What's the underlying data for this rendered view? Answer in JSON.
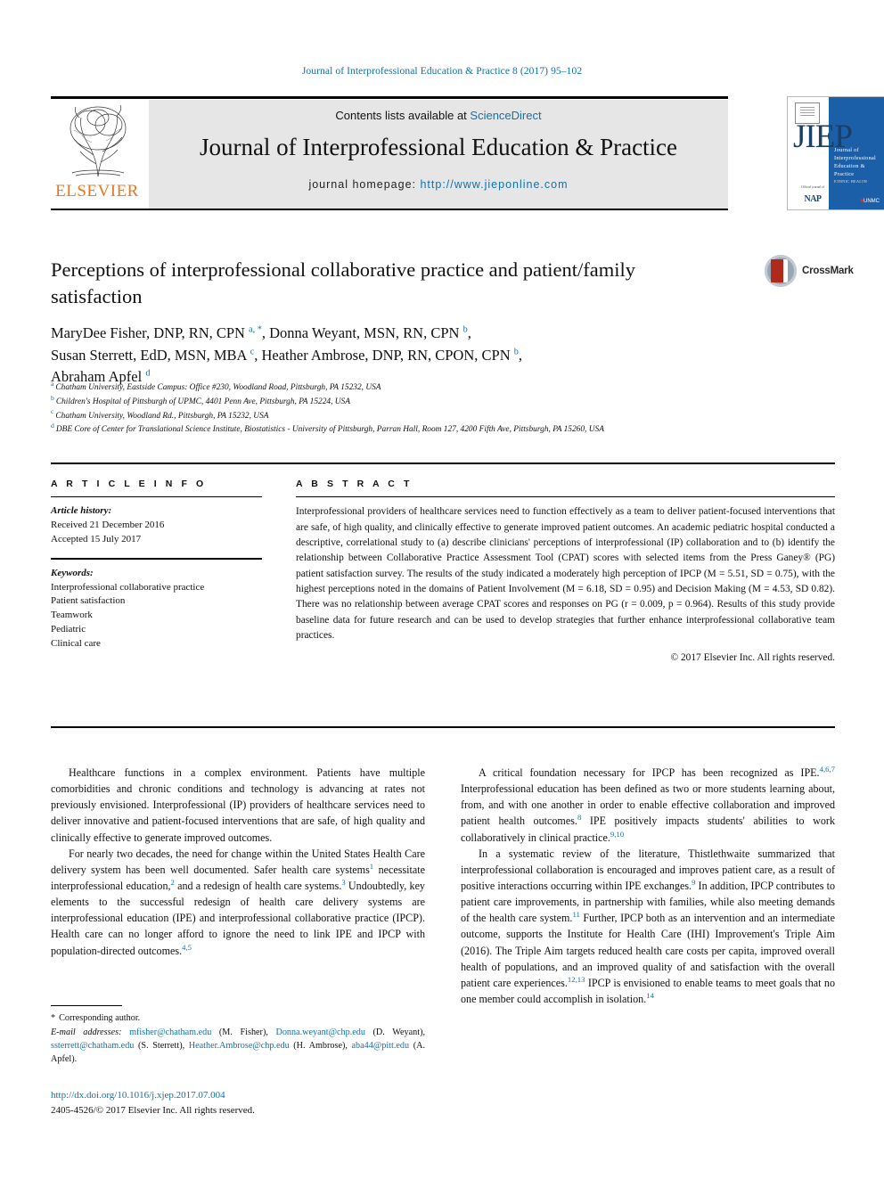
{
  "running_head": "Journal of Interprofessional Education & Practice 8 (2017) 95–102",
  "masthead": {
    "contents_prefix": "Contents lists available at ",
    "contents_link": "ScienceDirect",
    "journal_title": "Journal of Interprofessional Education & Practice",
    "homepage_prefix": "journal homepage: ",
    "homepage_url": "http://www.jieponline.com",
    "publisher": "ELSEVIER",
    "cover": {
      "acronym": "JIEP",
      "subtitle": "Journal of Interprofessional Education & Practice",
      "subtitle_small": "ETHNIC HEALTH",
      "nap_label": "Official journal of",
      "nap_badge": "NAP",
      "partner": "UNMC"
    }
  },
  "crossmark": {
    "label": "CrossMark"
  },
  "article": {
    "title": "Perceptions of interprofessional collaborative practice and patient/family satisfaction",
    "authors_html": "MaryDee Fisher, DNP, RN, CPN <sup>a, *</sup>, Donna Weyant, MSN, RN, CPN <sup>b</sup>,<br>Susan Sterrett, EdD, MSN, MBA <sup>c</sup>, Heather Ambrose, DNP, RN, CPON, CPN <sup>b</sup>,<br>Abraham Apfel <sup>d</sup>",
    "affiliations": [
      {
        "mark": "a",
        "text": "Chatham University, Eastside Campus: Office #230, Woodland Road, Pittsburgh, PA 15232, USA"
      },
      {
        "mark": "b",
        "text": "Children's Hospital of Pittsburgh of UPMC, 4401 Penn Ave, Pittsburgh, PA 15224, USA"
      },
      {
        "mark": "c",
        "text": "Chatham University, Woodland Rd., Pittsburgh, PA 15232, USA"
      },
      {
        "mark": "d",
        "text": "DBE Core of Center for Translational Science Institute, Biostatistics - University of Pittsburgh, Parran Hall, Room 127, 4200 Fifth Ave, Pittsburgh, PA 15260, USA"
      }
    ]
  },
  "article_info": {
    "heading": "A R T I C L E   I N F O",
    "history_label": "Article history:",
    "history_lines": [
      "Received 21 December 2016",
      "Accepted 15 July 2017"
    ],
    "keywords_label": "Keywords:",
    "keywords": [
      "Interprofessional collaborative practice",
      "Patient satisfaction",
      "Teamwork",
      "Pediatric",
      "Clinical care"
    ]
  },
  "abstract": {
    "heading": "A B S T R A C T",
    "text": "Interprofessional providers of healthcare services need to function effectively as a team to deliver patient-focused interventions that are safe, of high quality, and clinically effective to generate improved patient outcomes. An academic pediatric hospital conducted a descriptive, correlational study to (a) describe clinicians' perceptions of interprofessional (IP) collaboration and to (b) identify the relationship between Collaborative Practice Assessment Tool (CPAT) scores with selected items from the Press Ganey® (PG) patient satisfaction survey. The results of the study indicated a moderately high perception of IPCP (M = 5.51, SD = 0.75), with the highest perceptions noted in the domains of Patient Involvement (M = 6.18, SD = 0.95) and Decision Making (M = 4.53, SD 0.82). There was no relationship between average CPAT scores and responses on PG (r = 0.009, p = 0.964). Results of this study provide baseline data for future research and can be used to develop strategies that further enhance interprofessional collaborative team practices.",
    "copyright": "© 2017 Elsevier Inc. All rights reserved."
  },
  "body": {
    "left_paragraphs_html": [
      "Healthcare functions in a complex environment. Patients have multiple comorbidities and chronic conditions and technology is advancing at rates not previously envisioned. Interprofessional (IP) providers of healthcare services need to deliver innovative and patient-focused interventions that are safe, of high quality and clinically effective to generate improved outcomes.",
      "For nearly two decades, the need for change within the United States Health Care delivery system has been well documented. Safer health care systems<sup class=\"ref\">1</sup> necessitate interprofessional education,<sup class=\"ref\">2</sup> and a redesign of health care systems.<sup class=\"ref\">3</sup> Undoubtedly, key elements to the successful redesign of health care delivery systems are interprofessional education (IPE) and interprofessional collaborative practice (IPCP). Health care can no longer afford to ignore the need to link IPE and IPCP with population-directed outcomes.<sup class=\"ref\">4,5</sup>"
    ],
    "right_paragraphs_html": [
      "A critical foundation necessary for IPCP has been recognized as IPE.<sup class=\"ref\">4,6,7</sup> Interprofessional education has been defined as two or more students learning about, from, and with one another in order to enable effective collaboration and improved patient health outcomes.<sup class=\"ref\">8</sup> IPE positively impacts students' abilities to work collaboratively in clinical practice.<sup class=\"ref\">9,10</sup>",
      "In a systematic review of the literature, Thistlethwaite summarized that interprofessional collaboration is encouraged and improves patient care, as a result of positive interactions occurring within IPE exchanges.<sup class=\"ref\">9</sup> In addition, IPCP contributes to patient care improvements, in partnership with families, while also meeting demands of the health care system.<sup class=\"ref\">11</sup> Further, IPCP both as an intervention and an intermediate outcome, supports the Institute for Health Care (IHI) Improvement's Triple Aim (2016). The Triple Aim targets reduced health care costs per capita, improved overall health of populations, and an improved quality of and satisfaction with the overall patient care experiences.<sup class=\"ref\">12,13</sup> IPCP is envisioned to enable teams to meet goals that no one member could accomplish in isolation.<sup class=\"ref\">14</sup>"
    ]
  },
  "footnotes": {
    "corresponding": "Corresponding author.",
    "email_label": "E-mail addresses:",
    "emails_html": "<span class=\"link\">mfisher@chatham.edu</span> (M. Fisher), <span class=\"link\">Donna.weyant@chp.edu</span> (D. Weyant), <span class=\"link\">ssterrett@chatham.edu</span> (S. Sterrett), <span class=\"link\">Heather.Ambrose@chp.edu</span> (H. Ambrose), <span class=\"link\">aba44@pitt.edu</span> (A. Apfel)."
  },
  "doi_block": {
    "doi": "http://dx.doi.org/10.1016/j.xjep.2017.07.004",
    "issn_line": "2405-4526/© 2017 Elsevier Inc. All rights reserved."
  }
}
